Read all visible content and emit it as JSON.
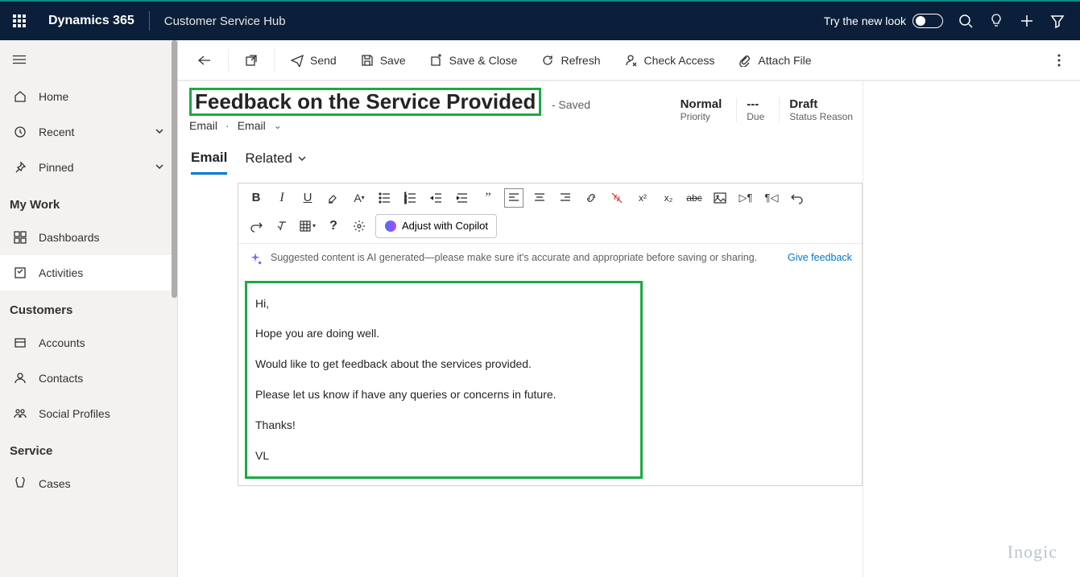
{
  "topbar": {
    "brand": "Dynamics 365",
    "app": "Customer Service Hub",
    "try_new": "Try the new look"
  },
  "sidebar": {
    "home": "Home",
    "recent": "Recent",
    "pinned": "Pinned",
    "sections": {
      "mywork": "My Work",
      "customers": "Customers",
      "service": "Service"
    },
    "dashboards": "Dashboards",
    "activities": "Activities",
    "accounts": "Accounts",
    "contacts": "Contacts",
    "social": "Social Profiles",
    "cases": "Cases"
  },
  "cmdbar": {
    "send": "Send",
    "save": "Save",
    "saveclose": "Save & Close",
    "refresh": "Refresh",
    "checkaccess": "Check Access",
    "attach": "Attach File"
  },
  "record": {
    "title": "Feedback on the Service Provided",
    "saved": "- Saved",
    "entity1": "Email",
    "entity2": "Email",
    "meta": {
      "priority_val": "Normal",
      "priority_lbl": "Priority",
      "due_val": "---",
      "due_lbl": "Due",
      "status_val": "Draft",
      "status_lbl": "Status Reason"
    }
  },
  "tabs": {
    "email": "Email",
    "related": "Related"
  },
  "rte": {
    "copilot": "Adjust with Copilot",
    "ai_banner": "Suggested content is AI generated—please make sure it's accurate and appropriate before saving or sharing.",
    "feedback": "Give feedback"
  },
  "body": {
    "l1": "Hi,",
    "l2": "Hope you are doing well.",
    "l3": "Would like to get feedback about the services provided.",
    "l4": "Please let us know if have any queries or concerns in future.",
    "l5": "Thanks!",
    "l6": "VL"
  },
  "watermark": "Inogic"
}
